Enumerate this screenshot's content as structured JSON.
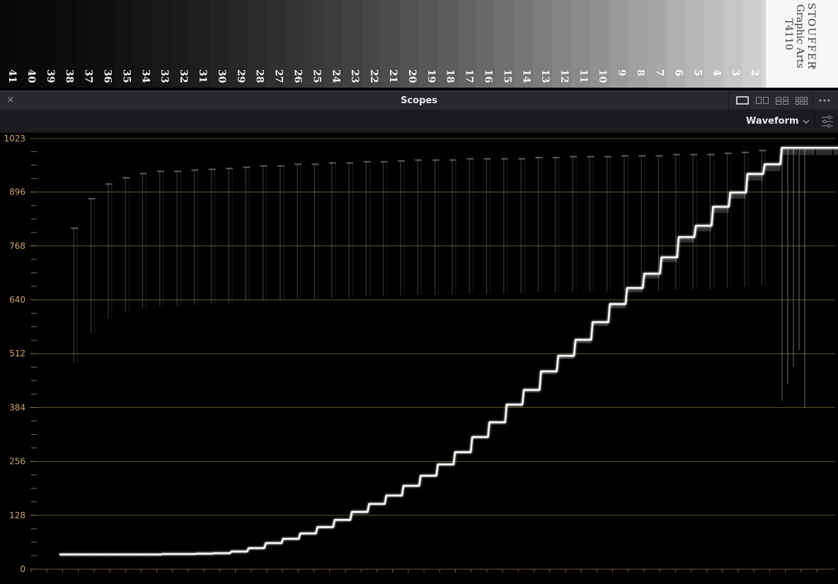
{
  "step_wedge": {
    "step_numbers": [
      "41",
      "40",
      "39",
      "38",
      "37",
      "36",
      "35",
      "34",
      "33",
      "32",
      "31",
      "30",
      "29",
      "28",
      "27",
      "26",
      "25",
      "24",
      "23",
      "22",
      "21",
      "20",
      "19",
      "18",
      "17",
      "16",
      "15",
      "14",
      "13",
      "12",
      "11",
      "10",
      "9",
      "8",
      "7",
      "6",
      "5",
      "4",
      "3",
      "2"
    ],
    "brand": "STOUFFER",
    "registered_mark": "®",
    "subtitle": "Graphic Arts",
    "model": "T4110"
  },
  "panel": {
    "title": "Scopes",
    "close_glyph": "×",
    "scope_mode": "Waveform",
    "layout_options": [
      "single-view",
      "dual-view",
      "quad-view",
      "full-grid-view"
    ],
    "selected_layout": "single-view"
  },
  "waveform": {
    "scale_labels": [
      "1023",
      "896",
      "768",
      "640",
      "512",
      "384",
      "256",
      "128",
      "0"
    ],
    "scale_values": [
      1023,
      896,
      768,
      640,
      512,
      384,
      256,
      128,
      0
    ],
    "scale_max": 1023,
    "graticule_color": "#8a7140",
    "label_color": "#c8a670",
    "trace_color": "#ffffff",
    "step_levels": [
      35,
      35,
      35,
      35,
      35,
      35,
      36,
      36,
      37,
      38,
      42,
      50,
      62,
      72,
      85,
      100,
      117,
      136,
      155,
      175,
      198,
      222,
      249,
      278,
      314,
      349,
      391,
      426,
      470,
      507,
      545,
      587,
      630,
      668,
      702,
      741,
      789,
      816,
      861,
      895,
      939,
      962,
      1001,
      1001,
      1001,
      1001,
      1001,
      1001,
      1001,
      1001,
      1001,
      1001,
      1001
    ],
    "peak_levels": [
      0,
      810,
      880,
      915,
      930,
      940,
      945,
      945,
      948,
      950,
      952,
      955,
      958,
      958,
      962,
      962,
      965,
      965,
      968,
      968,
      970,
      972,
      972,
      972,
      975,
      975,
      975,
      975,
      978,
      978,
      980,
      980,
      980,
      982,
      982,
      982,
      985,
      985,
      985,
      988,
      990,
      995
    ]
  }
}
